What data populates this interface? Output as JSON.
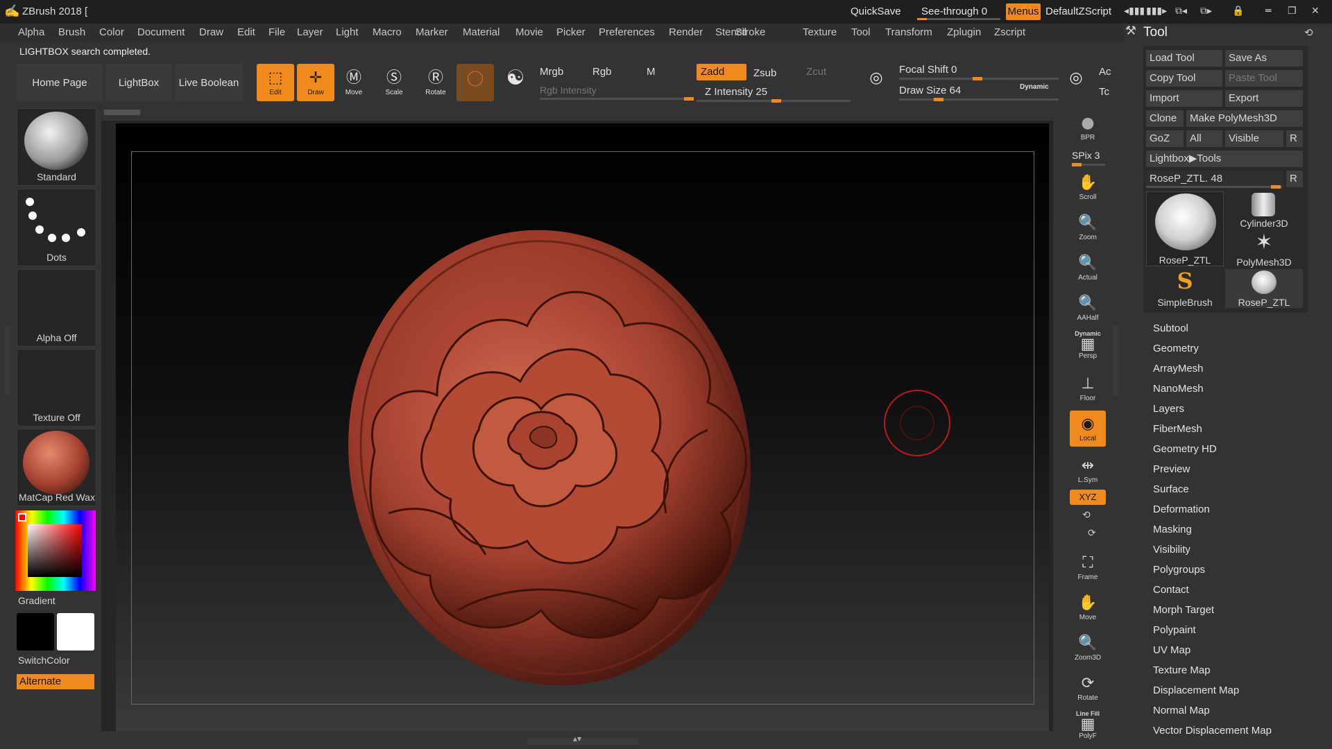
{
  "app": {
    "title": "ZBrush 2018 [",
    "quicksave": "QuickSave",
    "see_through": "See-through  0",
    "menus_label": "Menus",
    "script_name": "DefaultZScript",
    "status": "LIGHTBOX search completed."
  },
  "menubar": [
    "Alpha",
    "Brush",
    "Color",
    "Document",
    "Draw",
    "Edit",
    "File",
    "Layer",
    "Light",
    "Macro",
    "Marker",
    "Material",
    "Movie",
    "Picker",
    "Preferences",
    "Render",
    "Stencil",
    "Stroke",
    "Texture",
    "Tool",
    "Transform",
    "Zplugin",
    "Zscript"
  ],
  "shelf": {
    "home": "Home Page",
    "lightbox": "LightBox",
    "live_boolean": "Live Boolean",
    "edit": "Edit",
    "draw": "Draw",
    "move": "Move",
    "scale": "Scale",
    "rotate": "Rotate",
    "mrgb": "Mrgb",
    "rgb": "Rgb",
    "m": "M",
    "rgb_intensity": "Rgb Intensity",
    "zadd": "Zadd",
    "zsub": "Zsub",
    "zcut": "Zcut",
    "z_intensity": "Z Intensity 25",
    "focal_shift": "Focal Shift 0",
    "draw_size": "Draw Size 64",
    "dynamic": "Dynamic",
    "ac": "Ac",
    "tc": "Tc"
  },
  "lefttray": {
    "brush": "Standard",
    "stroke": "Dots",
    "alpha": "Alpha Off",
    "texture": "Texture Off",
    "material": "MatCap Red Wax",
    "gradient": "Gradient",
    "switchcolor": "SwitchColor",
    "alternate": "Alternate"
  },
  "rightshelf": {
    "bpr": "BPR",
    "spix": "SPix 3",
    "scroll": "Scroll",
    "zoom": "Zoom",
    "actual": "Actual",
    "aahalf": "AAHalf",
    "dynamic": "Dynamic",
    "persp": "Persp",
    "floor": "Floor",
    "local": "Local",
    "lsym": "L.Sym",
    "xyz": "XYZ",
    "frame": "Frame",
    "move": "Move",
    "zoom3d": "Zoom3D",
    "rotate": "Rotate",
    "linefill": "Line Fill",
    "polyf": "PolyF"
  },
  "toolpanel": {
    "title": "Tool",
    "load_tool": "Load Tool",
    "save_as": "Save As",
    "copy_tool": "Copy Tool",
    "paste_tool": "Paste Tool",
    "import": "Import",
    "export": "Export",
    "clone": "Clone",
    "make_polymesh": "Make PolyMesh3D",
    "goz": "GoZ",
    "all": "All",
    "visible": "Visible",
    "r": "R",
    "lightbox_tools": "Lightbox▶Tools",
    "current_tool": "RoseP_ZTL. 48",
    "thumbs": [
      "RoseP_ZTL",
      "Cylinder3D",
      "PolyMesh3D",
      "SimpleBrush",
      "RoseP_ZTL"
    ],
    "subpalettes": [
      "Subtool",
      "Geometry",
      "ArrayMesh",
      "NanoMesh",
      "Layers",
      "FiberMesh",
      "Geometry HD",
      "Preview",
      "Surface",
      "Deformation",
      "Masking",
      "Visibility",
      "Polygroups",
      "Contact",
      "Morph Target",
      "Polypaint",
      "UV Map",
      "Texture Map",
      "Displacement Map",
      "Normal Map",
      "Vector Displacement Map"
    ]
  },
  "colors": {
    "accent": "#f08a1c",
    "clay": "#a3402f",
    "background": "#333333"
  }
}
